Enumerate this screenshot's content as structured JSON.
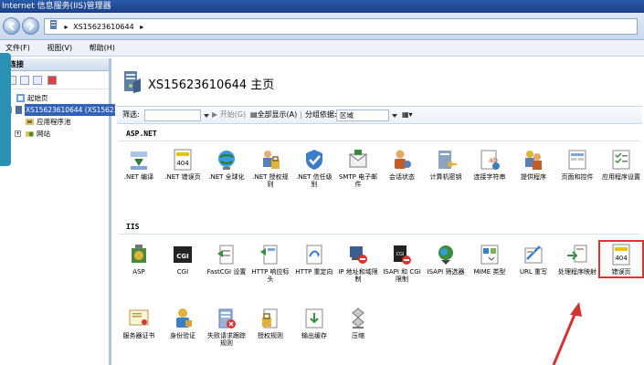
{
  "window": {
    "title": "Internet 信息服务(IIS)管理器"
  },
  "address": {
    "segments": [
      "XS15623610644",
      "▸"
    ]
  },
  "menu": {
    "items": [
      "文件(F)",
      "视图(V)",
      "帮助(H)"
    ]
  },
  "left_pane": {
    "title": "连接",
    "tree": [
      {
        "label": "起始页",
        "level": 0,
        "selected": false
      },
      {
        "label": "XS15623610644 (XS15623610644\\...)",
        "level": 0,
        "selected": true
      },
      {
        "label": "应用程序池",
        "level": 1,
        "selected": false
      },
      {
        "label": "网站",
        "level": 1,
        "selected": false
      }
    ]
  },
  "main": {
    "title": "XS15623610644 主页",
    "filter": {
      "label": "筛选:",
      "start": "开始(G)",
      "show_all": "全部显示(A)",
      "group_by_label": "分组依据:",
      "group_by_value": "区域"
    },
    "sections": [
      {
        "name": "ASP.NET",
        "items": [
          {
            "label": ".NET 编译",
            "icon": "dotnet-compile-icon"
          },
          {
            "label": ".NET 错误页",
            "icon": "dotnet-error-page-icon"
          },
          {
            "label": ".NET 全球化",
            "icon": "globe-icon"
          },
          {
            "label": ".NET 授权规则",
            "icon": "lock-user-icon"
          },
          {
            "label": ".NET 信任级别",
            "icon": "shield-check-icon"
          },
          {
            "label": "SMTP 电子邮件",
            "icon": "mail-icon"
          },
          {
            "label": "会话状态",
            "icon": "session-user-icon"
          },
          {
            "label": "计算机密钥",
            "icon": "machine-key-icon"
          },
          {
            "label": "连接字符串",
            "icon": "connection-string-icon"
          },
          {
            "label": "提供程序",
            "icon": "provider-users-icon"
          },
          {
            "label": "页面和控件",
            "icon": "pages-controls-icon"
          },
          {
            "label": "应用程序设置",
            "icon": "app-settings-icon"
          }
        ]
      },
      {
        "name": "IIS",
        "items": [
          {
            "label": "ASP",
            "icon": "asp-icon"
          },
          {
            "label": "CGI",
            "icon": "cgi-icon"
          },
          {
            "label": "FastCGI 设置",
            "icon": "fastcgi-icon"
          },
          {
            "label": "HTTP 响应标头",
            "icon": "http-headers-icon"
          },
          {
            "label": "HTTP 重定向",
            "icon": "http-redirect-icon"
          },
          {
            "label": "IP 地址和域限制",
            "icon": "ip-restrict-icon"
          },
          {
            "label": "ISAPI 和 CGI 限制",
            "icon": "isapi-cgi-icon"
          },
          {
            "label": "ISAPI 筛选器",
            "icon": "isapi-filter-icon"
          },
          {
            "label": "MIME 类型",
            "icon": "mime-icon"
          },
          {
            "label": "URL 重写",
            "icon": "url-rewrite-icon"
          },
          {
            "label": "处理程序映射",
            "icon": "handler-mapping-icon"
          },
          {
            "label": "错误页",
            "icon": "error-page-icon"
          },
          {
            "label": "服务器证书",
            "icon": "certificate-icon"
          },
          {
            "label": "身份验证",
            "icon": "authentication-icon"
          },
          {
            "label": "失败请求跟踪规则",
            "icon": "failed-request-icon"
          },
          {
            "label": "授权规则",
            "icon": "authorization-icon"
          },
          {
            "label": "输出缓存",
            "icon": "output-cache-icon"
          },
          {
            "label": "压缩",
            "icon": "compression-icon"
          }
        ]
      }
    ]
  },
  "colors": {
    "highlight": "#d33333",
    "selection": "#3161b8",
    "overlay_tab": "#2a91b5"
  }
}
